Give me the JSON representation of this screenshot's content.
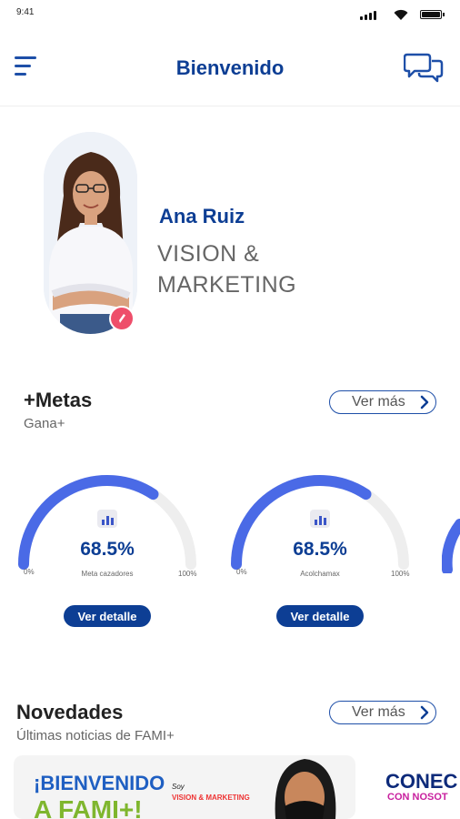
{
  "status_bar": {
    "time": "9:41"
  },
  "header": {
    "title": "Bienvenido"
  },
  "profile": {
    "name": "Ana Ruiz",
    "company_line1": "VISION &",
    "company_line2": "MARKETING"
  },
  "metas": {
    "title": "+Metas",
    "subtitle": "Gana+",
    "ver_mas": "Ver más",
    "gauges": [
      {
        "percent_text": "68.5%",
        "progress": 0.685,
        "label": "Meta cazadores",
        "min": "0%",
        "max": "100%",
        "button": "Ver detalle"
      },
      {
        "percent_text": "68.5%",
        "progress": 0.685,
        "label": "Acolchamax",
        "min": "0%",
        "max": "100%",
        "button": "Ver detalle"
      }
    ],
    "colors": {
      "progress": "#4a6ae6",
      "track": "#eeeeee"
    }
  },
  "novedades": {
    "title": "Novedades",
    "subtitle": "Últimas noticias de FAMI+",
    "ver_mas": "Ver más",
    "banner1": {
      "line1": "¡BIENVENIDO",
      "line2": "A FAMI+!",
      "brand_line1": "Soy",
      "brand_line2": "VISION & MARKETING"
    },
    "banner2": {
      "line1": "CONEC",
      "line2": "CON NOSOT"
    }
  },
  "colors": {
    "primary": "#0d3e94",
    "accent": "#1e4fa8",
    "badge": "#ee4e6a"
  },
  "icons": {
    "menu": "hamburger-menu-icon",
    "chat": "chat-bubbles-icon",
    "stats": "bar-chart-icon",
    "chevron": "chevron-right-icon",
    "edit": "pencil-icon"
  }
}
